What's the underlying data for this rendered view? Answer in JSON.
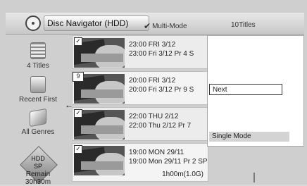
{
  "header": {
    "title": "Disc Navigator (HDD)",
    "mode_label": "Multi-Mode",
    "titles_count": "10Titles"
  },
  "sidebar": {
    "items": [
      {
        "label": "4 Titles",
        "icon": "list-icon"
      },
      {
        "label": "Recent First",
        "icon": "square-icon"
      },
      {
        "label": "All Genres",
        "icon": "box-icon"
      }
    ],
    "storage": {
      "line1": "HDD",
      "line2": "SP"
    },
    "remain_label": "Remain",
    "remain_value": "30h30m"
  },
  "titles": [
    {
      "badge": "✓",
      "line1": "23:00 FRI 3/12",
      "line2": "23:00  Fri 3/12 Pr 4  S"
    },
    {
      "badge": "9",
      "line1": "20:00  FRI 3/12",
      "line2": "20:00   Fri 3/12  Pr 9 S"
    },
    {
      "badge": "✓",
      "line1": "22:00  THU 2/12",
      "line2": "22:00   Thu 2/12  Pr 7"
    },
    {
      "badge": "✓",
      "line1": "19:00  MON 29/11",
      "line2": "19:00   Mon 29/11  Pr 2  SP",
      "duration": "1h00m(1.0G)"
    }
  ],
  "menu": {
    "next_label": "Next",
    "single_mode_label": "Single Mode"
  }
}
